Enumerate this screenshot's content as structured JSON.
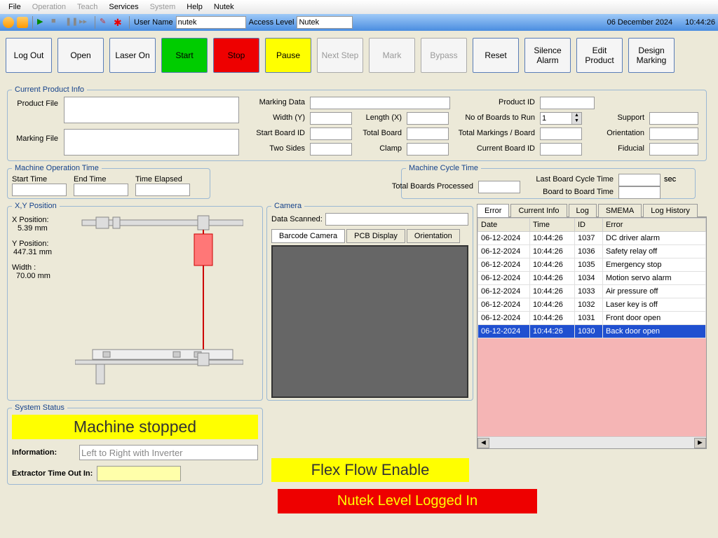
{
  "menu": {
    "file": "File",
    "operation": "Operation",
    "teach": "Teach",
    "services": "Services",
    "system": "System",
    "help": "Help",
    "nutek": "Nutek"
  },
  "toolbar": {
    "username_label": "User Name",
    "username_value": "nutek",
    "access_label": "Access Level",
    "access_value": "Nutek",
    "date": "06 December 2024",
    "time": "10:44:26"
  },
  "buttons": {
    "logout": "Log Out",
    "open": "Open",
    "laseron": "Laser On",
    "start": "Start",
    "stop": "Stop",
    "pause": "Pause",
    "nextstep": "Next Step",
    "mark": "Mark",
    "bypass": "Bypass",
    "reset": "Reset",
    "silence": "Silence\nAlarm",
    "editprod": "Edit\nProduct",
    "designmark": "Design\nMarking"
  },
  "cpi": {
    "legend": "Current Product Info",
    "product_file": "Product File",
    "marking_file": "Marking File",
    "marking_data": "Marking Data",
    "width_y": "Width (Y)",
    "start_board_id": "Start Board ID",
    "two_sides": "Two Sides",
    "length_x": "Length (X)",
    "total_board": "Total Board",
    "clamp": "Clamp",
    "product_id": "Product ID",
    "no_boards_run": "No of Boards to Run",
    "total_mpb": "Total Markings / Board",
    "current_bid": "Current Board ID",
    "no_boards_run_val": "1",
    "support": "Support",
    "orientation": "Orientation",
    "fiducial": "Fiducial"
  },
  "mot": {
    "legend": "Machine Operation Time",
    "start": "Start Time",
    "end": "End Time",
    "elapsed": "Time Elapsed"
  },
  "mct": {
    "legend": "Machine Cycle Time",
    "total_processed": "Total Boards Processed",
    "last_cycle": "Last Board Cycle Time",
    "btb": "Board to Board Time",
    "sec": "sec"
  },
  "xy": {
    "legend": "X,Y Position",
    "xpos_lbl": "X Position:",
    "xpos_val": "5.39  mm",
    "ypos_lbl": "Y Position:",
    "ypos_val": "447.31  mm",
    "w_lbl": "Width :",
    "w_val": "70.00  mm"
  },
  "camera": {
    "legend": "Camera",
    "data_scanned": "Data Scanned:",
    "tab_barcode": "Barcode Camera",
    "tab_pcb": "PCB Display",
    "tab_orient": "Orientation"
  },
  "errtabs": {
    "error": "Error",
    "current": "Current Info",
    "log": "Log",
    "smema": "SMEMA",
    "history": "Log History"
  },
  "errcols": {
    "date": "Date",
    "time": "Time",
    "id": "ID",
    "error": "Error"
  },
  "errors": [
    {
      "date": "06-12-2024",
      "time": "10:44:26",
      "id": "1037",
      "msg": "DC driver alarm"
    },
    {
      "date": "06-12-2024",
      "time": "10:44:26",
      "id": "1036",
      "msg": "Safety relay off"
    },
    {
      "date": "06-12-2024",
      "time": "10:44:26",
      "id": "1035",
      "msg": "Emergency stop"
    },
    {
      "date": "06-12-2024",
      "time": "10:44:26",
      "id": "1034",
      "msg": "Motion servo alarm"
    },
    {
      "date": "06-12-2024",
      "time": "10:44:26",
      "id": "1033",
      "msg": "Air pressure off"
    },
    {
      "date": "06-12-2024",
      "time": "10:44:26",
      "id": "1032",
      "msg": "Laser key is off"
    },
    {
      "date": "06-12-2024",
      "time": "10:44:26",
      "id": "1031",
      "msg": "Front door open"
    },
    {
      "date": "06-12-2024",
      "time": "10:44:26",
      "id": "1030",
      "msg": "Back door open"
    }
  ],
  "sys": {
    "legend": "System Status",
    "status": "Machine stopped",
    "info_lbl": "Information:",
    "info_val": "Left to Right with Inverter",
    "ext_lbl": "Extractor Time Out In:",
    "flex": "Flex Flow Enable"
  },
  "login": "Nutek Level Logged In"
}
